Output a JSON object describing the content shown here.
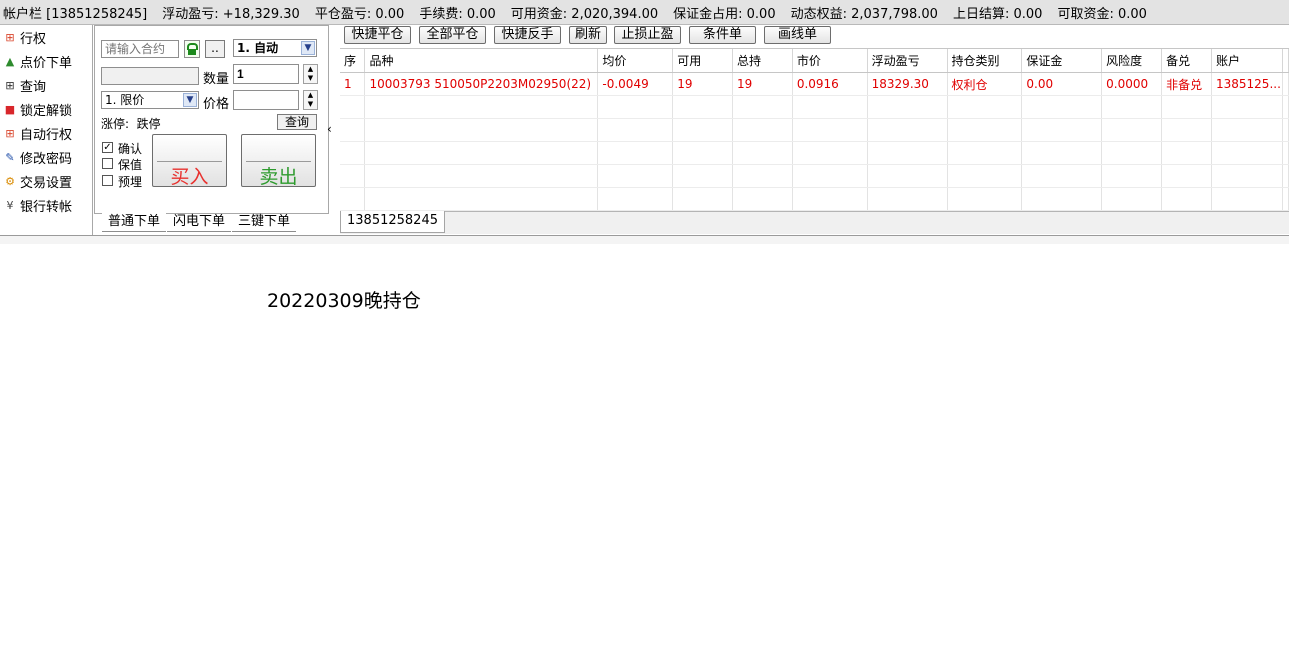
{
  "account_bar": {
    "account": "帐户栏 [13851258245]",
    "floating_pnl": "浮动盈亏: +18,329.30",
    "close_pnl": "平仓盈亏: 0.00",
    "fee": "手续费: 0.00",
    "available": "可用资金: 2,020,394.00",
    "margin_used": "保证金占用: 0.00",
    "dynamic_equity": "动态权益: 2,037,798.00",
    "last_settle": "上日结算: 0.00",
    "withdrawable": "可取资金: 0.00"
  },
  "left_menu": [
    {
      "label": "行权",
      "icon": "exercise-icon",
      "color": "#d9452b",
      "glyph": "⊞"
    },
    {
      "label": "点价下单",
      "icon": "price-order-icon",
      "color": "#2e8b2e",
      "glyph": "▲"
    },
    {
      "label": "查询",
      "icon": "query-icon",
      "color": "#333333",
      "glyph": "⊞"
    },
    {
      "label": "锁定解锁",
      "icon": "lock-icon",
      "color": "#d8262b",
      "glyph": "■"
    },
    {
      "label": "自动行权",
      "icon": "auto-exercise-icon",
      "color": "#d9452b",
      "glyph": "⊞"
    },
    {
      "label": "修改密码",
      "icon": "edit-password-icon",
      "color": "#1f4ea8",
      "glyph": "✎"
    },
    {
      "label": "交易设置",
      "icon": "settings-icon",
      "color": "#d98a00",
      "glyph": "⚙"
    },
    {
      "label": "银行转帐",
      "icon": "bank-transfer-icon",
      "color": "#444444",
      "glyph": "¥"
    }
  ],
  "order_panel": {
    "contract_placeholder": "请输入合约",
    "dots_label": "..",
    "mode_value": "1. 自动",
    "qty_label": "数量",
    "qty_value": "1",
    "price_type": "1. 限价",
    "price_label": "价格",
    "limit_text": "涨停:  跌停",
    "query_label": "查询",
    "checkboxes": [
      {
        "label": "确认",
        "checked": true
      },
      {
        "label": "保值",
        "checked": false
      },
      {
        "label": "预埋",
        "checked": false
      }
    ],
    "buy_label": "买入",
    "sell_label": "卖出",
    "tabs": [
      "普通下单",
      "闪电下单",
      "三键下单"
    ]
  },
  "toolbar": [
    "快捷平仓",
    "全部平仓",
    "快捷反手",
    "刷新",
    "止损止盈",
    "条件单",
    "画线单"
  ],
  "positions": {
    "columns": [
      "序",
      "品种",
      "均价",
      "可用",
      "总持",
      "市价",
      "浮动盈亏",
      "持仓类别",
      "保证金",
      "风险度",
      "备兑",
      "账户"
    ],
    "rows": [
      [
        "1",
        "10003793 510050P2203M02950(22)",
        "-0.0049",
        "19",
        "19",
        "0.0916",
        "18329.30",
        "权利仓",
        "0.00",
        "0.0000",
        "非备兑",
        "1385125..."
      ]
    ]
  },
  "account_tab": "13851258245",
  "caption": "20220309晚持仓",
  "colors": {
    "buy": "#e8322f",
    "sell": "#2e9b2e",
    "row_text": "#e00000"
  }
}
